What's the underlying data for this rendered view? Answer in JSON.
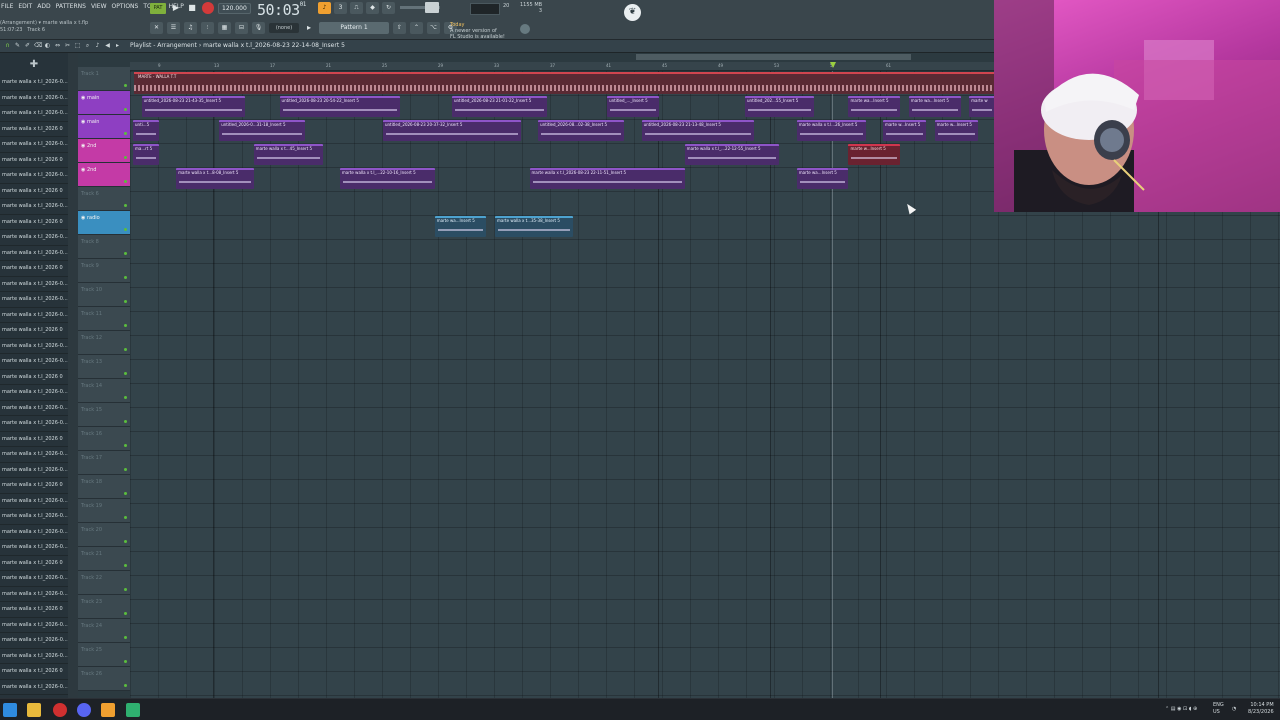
{
  "menu": [
    "FILE",
    "EDIT",
    "ADD",
    "PATTERNS",
    "VIEW",
    "OPTIONS",
    "TOOLS",
    "HELP"
  ],
  "project": {
    "line1": "(Arrangement) ▾",
    "file": "marte walla x t.flp",
    "line2": "51:07:23",
    "track": "Track 6"
  },
  "transport": {
    "pat_label": "PAT",
    "tempo": "120.000",
    "time": "50:03",
    "time_small": "01"
  },
  "toolbar": {
    "memory": "1155 MB",
    "memory_sub": "3",
    "cpu_value": "20",
    "pattern": "Pattern 1",
    "none": "(none)",
    "news_line1": "Today",
    "news_line2": "A newer version of",
    "news_line3": "FL Studio is available!"
  },
  "playlist": {
    "title": "Playlist - Arrangement › marte walla x t.l_2026-08-23 22-14-08_Insert 5"
  },
  "picker_items": [
    "marte walla x t.l_2026-0...",
    "marte walla x t.l_2026-0...",
    "marte walla x t.l_2026-0...",
    "marte walla x t.l_2026 0",
    "marte walla x t.l_2026-0...",
    "marte walla x t.l_2026 0",
    "marte walla x t.l_2026-0...",
    "marte walla x t.l_2026 0",
    "marte walla x t.l_2026-0...",
    "marte walla x t.l_2026 0",
    "marte walla x t.l_2026-0...",
    "marte walla x t.l_2026-0...",
    "marte walla x t.l_2026 0",
    "marte walla x t.l_2026-0...",
    "marte walla x t.l_2026-0...",
    "marte walla x t.l_2026-0...",
    "marte walla x t.l_2026 0",
    "marte walla x t.l_2026-0...",
    "marte walla x t.l_2026-0...",
    "marte walla x t.l_2026 0",
    "marte walla x t.l_2026-0...",
    "marte walla x t.l_2026-0...",
    "marte walla x t.l_2026-0...",
    "marte walla x t.l_2026 0",
    "marte walla x t.l_2026-0...",
    "marte walla x t.l_2026-0...",
    "marte walla x t.l_2026 0",
    "marte walla x t.l_2026-0...",
    "marte walla x t.l_2026-0...",
    "marte walla x t.l_2026-0...",
    "marte walla x t.l_2026-0...",
    "marte walla x t.l_2026 0",
    "marte walla x t.l_2026-0...",
    "marte walla x t.l_2026-0...",
    "marte walla x t.l_2026 0",
    "marte walla x t.l_2026-0...",
    "marte walla x t.l_2026-0...",
    "marte walla x t.l_2026-0...",
    "marte walla x t.l_2026 0",
    "marte walla x t.l_2026-0...",
    "marte walla x t.l_2026-0..."
  ],
  "tracks": [
    {
      "name": "Track 1",
      "color": ""
    },
    {
      "name": "main",
      "color": "#8e3fc2"
    },
    {
      "name": "main",
      "color": "#8e3fc2"
    },
    {
      "name": "2nd",
      "color": "#c43aa6"
    },
    {
      "name": "2nd",
      "color": "#c43aa6"
    },
    {
      "name": "Track 6",
      "color": ""
    },
    {
      "name": "radio",
      "color": "#3a8fc0"
    },
    {
      "name": "Track 8",
      "color": ""
    },
    {
      "name": "Track 9",
      "color": ""
    },
    {
      "name": "Track 10",
      "color": ""
    },
    {
      "name": "Track 11",
      "color": ""
    },
    {
      "name": "Track 12",
      "color": ""
    },
    {
      "name": "Track 13",
      "color": ""
    },
    {
      "name": "Track 14",
      "color": ""
    },
    {
      "name": "Track 15",
      "color": ""
    },
    {
      "name": "Track 16",
      "color": ""
    },
    {
      "name": "Track 17",
      "color": ""
    },
    {
      "name": "Track 18",
      "color": ""
    },
    {
      "name": "Track 19",
      "color": ""
    },
    {
      "name": "Track 20",
      "color": ""
    },
    {
      "name": "Track 21",
      "color": ""
    },
    {
      "name": "Track 22",
      "color": ""
    },
    {
      "name": "Track 23",
      "color": ""
    },
    {
      "name": "Track 24",
      "color": ""
    },
    {
      "name": "Track 25",
      "color": ""
    },
    {
      "name": "Track 26",
      "color": ""
    }
  ],
  "timeline_ticks": [
    "9",
    "13",
    "17",
    "21",
    "25",
    "29",
    "33",
    "37",
    "41",
    "45",
    "49",
    "53",
    "57",
    "61"
  ],
  "master_clip_label": "MARTE - WALLA T.T",
  "clips": [
    {
      "row": 1,
      "start": 0.01,
      "end": 0.13,
      "color": "purple",
      "label": "untitled_2026-08-23 21-43-35_Insert 5"
    },
    {
      "row": 1,
      "start": 0.17,
      "end": 0.31,
      "color": "purple",
      "label": "untitled_2026-08-23 20-54-22_Insert 5"
    },
    {
      "row": 1,
      "start": 0.37,
      "end": 0.48,
      "color": "purple",
      "label": "untitled_2026-08-23 21-01-22_Insert 5"
    },
    {
      "row": 1,
      "start": 0.55,
      "end": 0.61,
      "color": "purple",
      "label": "untitled_..._Insert 5"
    },
    {
      "row": 1,
      "start": 0.71,
      "end": 0.79,
      "color": "purple",
      "label": "untitled_202...55_Insert 5"
    },
    {
      "row": 1,
      "start": 0.83,
      "end": 0.89,
      "color": "purple",
      "label": "marte wa...Insert 5"
    },
    {
      "row": 1,
      "start": 0.9,
      "end": 0.96,
      "color": "purple",
      "label": "marte wa...Insert 5"
    },
    {
      "row": 1,
      "start": 0.97,
      "end": 1.0,
      "color": "purple",
      "label": "marte w"
    },
    {
      "row": 2,
      "start": 0.0,
      "end": 0.03,
      "color": "purple",
      "label": "unti...5"
    },
    {
      "row": 2,
      "start": 0.1,
      "end": 0.2,
      "color": "purple",
      "label": "untitled_2026-0...31-18_Insert 5"
    },
    {
      "row": 2,
      "start": 0.29,
      "end": 0.45,
      "color": "purple",
      "label": "untitled_2026-08-23 20-37-32_Insert 5"
    },
    {
      "row": 2,
      "start": 0.47,
      "end": 0.57,
      "color": "purple",
      "label": "untitled_2026-08...02-38_Insert 5"
    },
    {
      "row": 2,
      "start": 0.59,
      "end": 0.72,
      "color": "purple",
      "label": "untitled_2026-08-23 21-13-48_Insert 5"
    },
    {
      "row": 2,
      "start": 0.77,
      "end": 0.85,
      "color": "purple",
      "label": "marte walla x t.l...26_Insert 5"
    },
    {
      "row": 2,
      "start": 0.87,
      "end": 0.92,
      "color": "purple",
      "label": "marte w...Insert 5"
    },
    {
      "row": 2,
      "start": 0.93,
      "end": 0.98,
      "color": "purple",
      "label": "marte w...Insert 5"
    },
    {
      "row": 3,
      "start": 0.0,
      "end": 0.03,
      "color": "purple",
      "label": "ma...rt 5"
    },
    {
      "row": 3,
      "start": 0.14,
      "end": 0.22,
      "color": "purple",
      "label": "marte walla x t...45_Insert 5"
    },
    {
      "row": 3,
      "start": 0.64,
      "end": 0.75,
      "color": "purple",
      "label": "marte walla x t.l_...22-12-55_Insert 5"
    },
    {
      "row": 3,
      "start": 0.83,
      "end": 0.89,
      "color": "red",
      "label": "marte w...Insert 5"
    },
    {
      "row": 4,
      "start": 0.05,
      "end": 0.14,
      "color": "purple",
      "label": "marte walla x t...8-08_Insert 5"
    },
    {
      "row": 4,
      "start": 0.24,
      "end": 0.35,
      "color": "purple",
      "label": "marte walla x t.l_...22-10-16_Insert 5"
    },
    {
      "row": 4,
      "start": 0.46,
      "end": 0.64,
      "color": "purple",
      "label": "marte walla x t.l_2026-08-23 22-11-51_Insert 5"
    },
    {
      "row": 4,
      "start": 0.77,
      "end": 0.83,
      "color": "purple",
      "label": "marte wa...Insert 5"
    },
    {
      "row": 6,
      "start": 0.35,
      "end": 0.41,
      "color": "blue",
      "label": "marte wa...Insert 5"
    },
    {
      "row": 6,
      "start": 0.42,
      "end": 0.51,
      "color": "blue",
      "label": "marte walla x t...35-38_Insert 5"
    }
  ],
  "taskbar": {
    "lang1": "ENG",
    "lang2": "US",
    "time": "10:14 PM",
    "date": "8/23/2026"
  }
}
